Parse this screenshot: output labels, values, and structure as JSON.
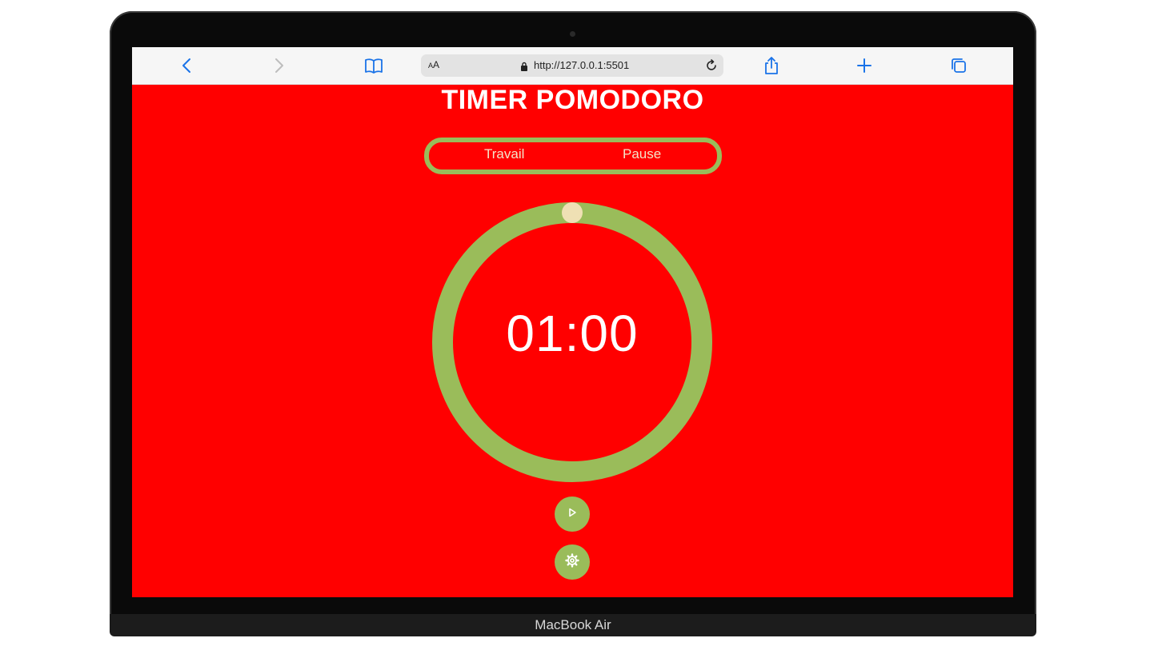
{
  "device": {
    "label": "MacBook Air"
  },
  "browser": {
    "aa_label_small": "A",
    "aa_label_large": "A",
    "url": "http://127.0.0.1:5501",
    "icons": [
      "back-icon",
      "forward-icon",
      "bookmarks-icon",
      "lock-icon",
      "reload-icon",
      "share-icon",
      "new-tab-icon",
      "tabs-icon"
    ]
  },
  "app": {
    "title": "TIMER POMODORO",
    "modes": [
      "Travail",
      "Pause"
    ],
    "timer": "01:00",
    "progress": 1.0,
    "controls": [
      "play-icon",
      "gear-icon"
    ]
  },
  "colors": {
    "background": "#ff0000",
    "accent": "#9abc5a",
    "knob": "#efe0b4",
    "mode_text": "#f4e4c8",
    "browser_blue": "#1a73e8"
  }
}
